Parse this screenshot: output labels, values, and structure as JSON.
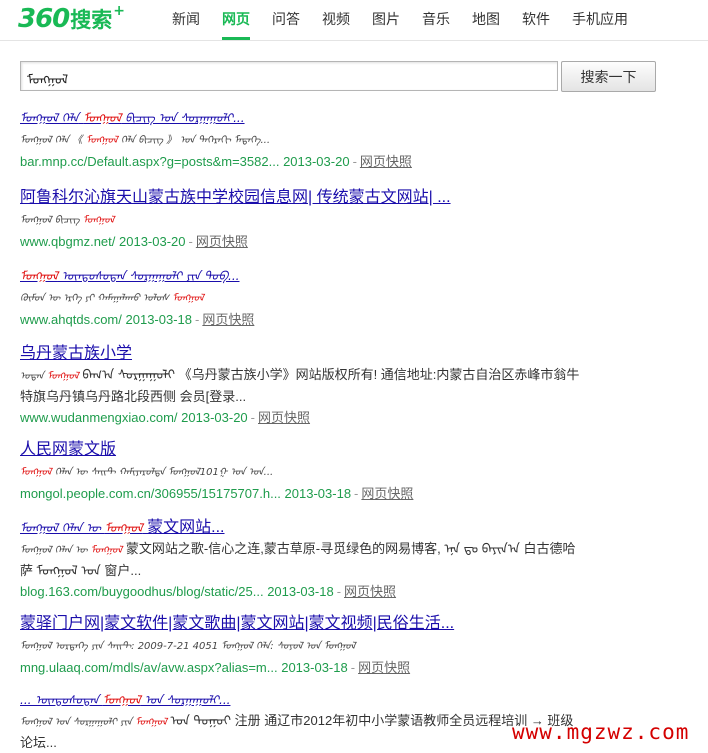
{
  "logo": {
    "num": "360",
    "word": "搜索",
    "plus": "+"
  },
  "nav": [
    "新闻",
    "网页",
    "问答",
    "视频",
    "图片",
    "音乐",
    "地图",
    "软件",
    "手机应用"
  ],
  "search": {
    "query": "ᠮᠣᠩᠭᠣᠯ",
    "button": "搜索一下"
  },
  "results": [
    {
      "title_pre": "ᠮᠣᠩᠭᠣᠯ ᠬᠡᠯᠡ",
      "title_hl": "ᠮᠣᠩᠭᠣᠯ",
      "title_post": " ᠪᠢᠴᠢᠭ ᠤᠨ ᠰᠤᠷᠭᠠᠭᠤᠯᠢ...",
      "snip_pre": "ᠮᠣᠩᠭᠣᠯ ᠬᠡᠯᠡ 《 ",
      "snip_hl": "ᠮᠣᠩᠭᠣᠯ",
      "snip_post": " ᠬᠡᠯᠡ ᠪᠢᠴᠢᠭ 》 ᠤᠨ ᠳᠡᠭᠡᠷᠡᠬᠢ ᠮᠡᠳᠡᠭᠡ...",
      "url": "bar.mnp.cc/Default.aspx?g=posts&m=3582...",
      "date": "2013-03-20",
      "snapshot": "网页快照"
    },
    {
      "title": "阿鲁科尔沁旗天山蒙古族中学校园信息网| 传统蒙古文网站| ...",
      "snip_pre": "ᠮᠣᠩᠭᠣᠯ ᠪᠢᠴᠢᠭ ",
      "snip_hl": "ᠮᠣᠩᠭᠣᠯ",
      "snip_post": "",
      "url": "www.qbgmz.net/",
      "date": "2013-03-20",
      "snapshot": "网页快照"
    },
    {
      "title_hl": "ᠮᠣᠩᠭᠣᠯ",
      "title_post": " ᠦᠨᠳᠦᠰᠦᠲᠡᠨ ᠰᠤᠷᠭᠠᠭᠤᠯᠢ ᠶᠢᠨ ᠲᠣᠪ...",
      "snip_pre": "ᠬᠦᠮᠦᠨ ᠦ ᠡᠷᠬᠡ ᠶᠢ ᠬᠠᠮᠠᠭᠠᠯᠠᠬᠤ ᠤᠯᠤᠰ ",
      "snip_hl": "ᠮᠣᠩᠭᠣᠯ",
      "snip_post": "",
      "url": "www.ahqtds.com/",
      "date": "2013-03-18",
      "snapshot": "网页快照"
    },
    {
      "title": "乌丹蒙古族小学",
      "snip_pre": "ᠤᠳᠠᠨ ",
      "snip_hl": "ᠮᠣᠩᠭᠣᠯ",
      "snip_post": " ᠪᠠᠭ᠎ᠠ ᠰᠤᠷᠭᠠᠭᠤᠯᠢ 《乌丹蒙古族小学》网站版权所有! 通信地址:内蒙古自治区赤峰市翁牛特旗乌丹镇乌丹路北段西侧 会员[登录...",
      "url": "www.wudanmengxiao.com/",
      "date": "2013-03-20",
      "snapshot": "网页快照"
    },
    {
      "title": "人民网蒙文版",
      "snip_pre": "",
      "snip_hl": "ᠮᠣᠩᠭᠣᠯ",
      "snip_post": " ᠬᠡᠯᠡᠨ ᠦ ᠰᠠᠢᠲ ᠬᠠᠮᠢᠶᠠᠷᠤᠯᠳᠠ ᠮᠣᠩᠭᠣᠯ101ᠭ ᠤᠨ ᠣᠨ...",
      "url": "mongol.people.com.cn/306955/15175707.h...",
      "date": "2013-03-18",
      "snapshot": "网页快照"
    },
    {
      "title_pre": "ᠮᠣᠩᠭᠣᠯ ᠬᠡᠯᠡᠨ ᠦ ",
      "title_hl": "ᠮᠣᠩᠭᠣᠯ",
      "title_post": " 蒙文网站...",
      "snip_pre": "ᠮᠣᠩᠭᠣᠯ ᠬᠡᠯᠡᠨ ᠦ ",
      "snip_hl": "ᠮᠣᠩᠭᠣᠯ",
      "snip_post": " 蒙文网站之歌-信心之连,蒙古草原-寻觅绿色的网易博客, ᠡᠨᠡ ᠳᠤ ᠪᠠᠶᠢᠨ᠎ᠠ 白古德哈萨 ᠮᠣᠩᠭᠣᠯ ᠤᠨ 窗户...",
      "url": "blog.163.com/buygoodhus/blog/static/25...",
      "date": "2013-03-18",
      "snapshot": "网页快照"
    },
    {
      "title": "蒙驿门户网|蒙文软件|蒙文歌曲|蒙文网站|蒙文视频|民俗生活...",
      "snip_pre": "ᠮᠣᠩᠭᠣᠯ ᠤᠷᠲᠠᠭᠡ ᠶᠢᠨ ᠰᠠᠢᠲ: 2009-7-21 4051 ᠮᠣᠩᠭᠣᠯ ᠬᠡᠯᠡ: ᠰᠣᠶᠣᠯ ᠤᠨ ᠮᠣᠩᠭᠣᠯ ",
      "snip_hl": "",
      "snip_post": "",
      "url": "mng.ulaaq.com/mdls/av/avw.aspx?alias=m...",
      "date": "2013-03-18",
      "snapshot": "网页快照"
    },
    {
      "title_pre": "... ᠦᠨᠳᠦᠰᠦᠲᠡᠨ ",
      "title_hl": "ᠮᠣᠩᠭᠣᠯ",
      "title_post": " ᠤᠨ ᠰᠤᠷᠭᠠᠭᠤᠯᠢ...",
      "snip_pre": "ᠮᠣᠩᠭᠣᠯ ᠤᠨ ᠰᠤᠷᠭᠠᠭᠤᠯᠢ ᠶᠢᠨ ",
      "snip_hl": "ᠮᠣᠩᠭᠣᠯ",
      "snip_post": " ᠤᠨ ᠳᠤᠭᠤᠢ 注册 通辽市2012年初中小学蒙语教师全员远程培训 → 班级论坛...",
      "url": "",
      "date": "",
      "snapshot": ""
    }
  ],
  "watermark": "www.mgzwz.com"
}
